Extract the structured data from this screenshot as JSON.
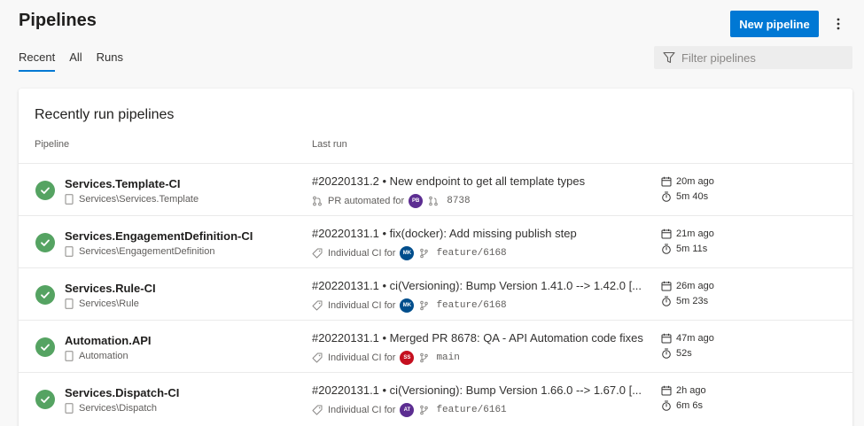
{
  "header": {
    "title": "Pipelines",
    "new_button": "New pipeline"
  },
  "tabs": [
    {
      "label": "Recent",
      "active": true
    },
    {
      "label": "All",
      "active": false
    },
    {
      "label": "Runs",
      "active": false
    }
  ],
  "filter": {
    "placeholder": "Filter pipelines"
  },
  "card": {
    "title": "Recently run pipelines",
    "col_pipeline": "Pipeline",
    "col_last_run": "Last run"
  },
  "rows": [
    {
      "name": "Services.Template-CI",
      "path": "Services\\Services.Template",
      "run_title": "#20220131.2 • New endpoint to get all template types",
      "trigger": "PR automated for",
      "avatar": "PB",
      "avatar_color": "#5c2d91",
      "ref": "8738",
      "ref_type": "pr",
      "started": "20m ago",
      "duration": "5m 40s"
    },
    {
      "name": "Services.EngagementDefinition-CI",
      "path": "Services\\EngagementDefinition",
      "run_title": "#20220131.1 • fix(docker): Add missing publish step",
      "trigger": "Individual CI for",
      "avatar": "MK",
      "avatar_color": "#004e8c",
      "ref": "feature/6168",
      "ref_type": "branch",
      "started": "21m ago",
      "duration": "5m 11s"
    },
    {
      "name": "Services.Rule-CI",
      "path": "Services\\Rule",
      "run_title": "#20220131.1 • ci(Versioning): Bump Version 1.41.0 --> 1.42.0 [...",
      "trigger": "Individual CI for",
      "avatar": "MK",
      "avatar_color": "#004e8c",
      "ref": "feature/6168",
      "ref_type": "branch",
      "started": "26m ago",
      "duration": "5m 23s"
    },
    {
      "name": "Automation.API",
      "path": "Automation",
      "run_title": "#20220131.1 • Merged PR 8678: QA - API Automation code fixes",
      "trigger": "Individual CI for",
      "avatar": "SS",
      "avatar_color": "#c50f1f",
      "ref": "main",
      "ref_type": "branch",
      "started": "47m ago",
      "duration": "52s"
    },
    {
      "name": "Services.Dispatch-CI",
      "path": "Services\\Dispatch",
      "run_title": "#20220131.1 • ci(Versioning): Bump Version 1.66.0 --> 1.67.0 [...",
      "trigger": "Individual CI for",
      "avatar": "AT",
      "avatar_color": "#5c2d91",
      "ref": "feature/6161",
      "ref_type": "branch",
      "started": "2h ago",
      "duration": "6m 6s"
    }
  ],
  "colors": {
    "accent": "#0078d4",
    "success": "#55a362"
  }
}
